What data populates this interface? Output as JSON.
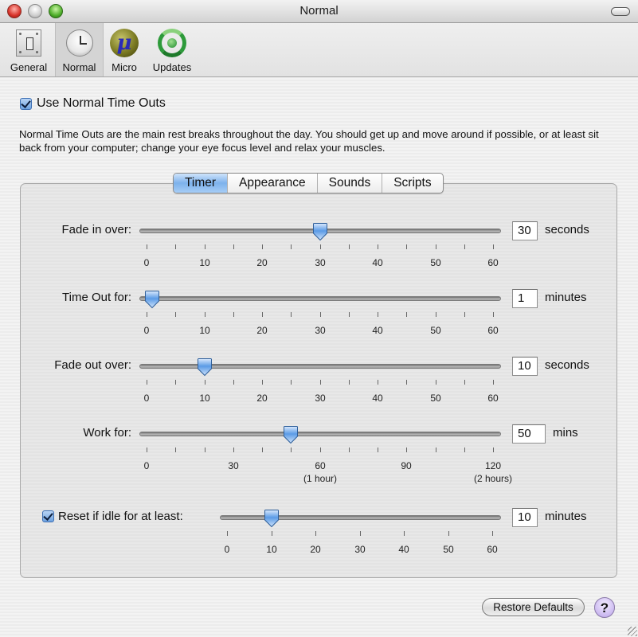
{
  "window": {
    "title": "Normal"
  },
  "toolbar": {
    "items": [
      {
        "label": "General",
        "icon": "light-switch-icon",
        "selected": false
      },
      {
        "label": "Normal",
        "icon": "clock-icon",
        "selected": true
      },
      {
        "label": "Micro",
        "icon": "micro-mu-icon",
        "selected": false
      },
      {
        "label": "Updates",
        "icon": "refresh-arrows-icon",
        "selected": false
      }
    ]
  },
  "use_normal": {
    "label": "Use Normal Time Outs",
    "checked": true
  },
  "description": "Normal Time Outs are the main rest breaks throughout the day.  You should get up and move around if possible, or at least sit back from your computer; change your eye focus level and relax your muscles.",
  "tabs": [
    {
      "label": "Timer",
      "active": true
    },
    {
      "label": "Appearance",
      "active": false
    },
    {
      "label": "Sounds",
      "active": false
    },
    {
      "label": "Scripts",
      "active": false
    }
  ],
  "sliders": [
    {
      "label": "Fade in over:",
      "min": 0,
      "max": 60,
      "value": 30,
      "minor_step": 5,
      "tick_labels": [
        {
          "v": 0,
          "t": "0"
        },
        {
          "v": 10,
          "t": "10"
        },
        {
          "v": 20,
          "t": "20"
        },
        {
          "v": 30,
          "t": "30"
        },
        {
          "v": 40,
          "t": "40"
        },
        {
          "v": 50,
          "t": "50"
        },
        {
          "v": 60,
          "t": "60"
        }
      ],
      "field_value": "30",
      "unit": "seconds"
    },
    {
      "label": "Time Out for:",
      "min": 0,
      "max": 60,
      "value": 1,
      "minor_step": 5,
      "tick_labels": [
        {
          "v": 0,
          "t": "0"
        },
        {
          "v": 10,
          "t": "10"
        },
        {
          "v": 20,
          "t": "20"
        },
        {
          "v": 30,
          "t": "30"
        },
        {
          "v": 40,
          "t": "40"
        },
        {
          "v": 50,
          "t": "50"
        },
        {
          "v": 60,
          "t": "60"
        }
      ],
      "field_value": "1",
      "unit": "minutes"
    },
    {
      "label": "Fade out over:",
      "min": 0,
      "max": 60,
      "value": 10,
      "minor_step": 5,
      "tick_labels": [
        {
          "v": 0,
          "t": "0"
        },
        {
          "v": 10,
          "t": "10"
        },
        {
          "v": 20,
          "t": "20"
        },
        {
          "v": 30,
          "t": "30"
        },
        {
          "v": 40,
          "t": "40"
        },
        {
          "v": 50,
          "t": "50"
        },
        {
          "v": 60,
          "t": "60"
        }
      ],
      "field_value": "10",
      "unit": "seconds"
    },
    {
      "label": "Work for:",
      "min": 0,
      "max": 120,
      "value": 50,
      "minor_step": 10,
      "tick_labels": [
        {
          "v": 0,
          "t": "0"
        },
        {
          "v": 30,
          "t": "30"
        },
        {
          "v": 60,
          "t": "60",
          "sub": "(1 hour)"
        },
        {
          "v": 90,
          "t": "90"
        },
        {
          "v": 120,
          "t": "120",
          "sub": "(2 hours)"
        }
      ],
      "field_value": "50",
      "unit": "mins"
    },
    {
      "label": "Reset if idle for at least:",
      "checkbox": true,
      "checked": true,
      "min": 0,
      "max": 60,
      "value": 10,
      "minor_step": 10,
      "tick_labels": [
        {
          "v": 0,
          "t": "0"
        },
        {
          "v": 10,
          "t": "10"
        },
        {
          "v": 20,
          "t": "20"
        },
        {
          "v": 30,
          "t": "30"
        },
        {
          "v": 40,
          "t": "40"
        },
        {
          "v": 50,
          "t": "50"
        },
        {
          "v": 60,
          "t": "60"
        }
      ],
      "field_value": "10",
      "unit": "minutes"
    }
  ],
  "buttons": {
    "restore_defaults": "Restore Defaults",
    "help": "?"
  },
  "colors": {
    "accent_blue": "#7db2ec",
    "thumb_blue": "#5b9be6"
  }
}
